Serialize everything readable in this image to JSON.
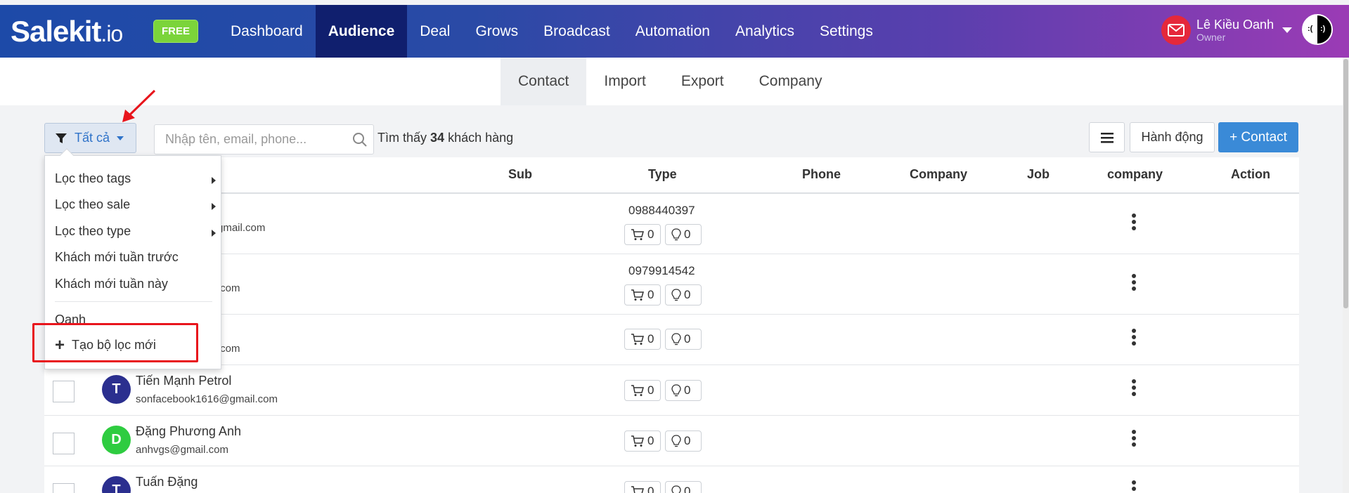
{
  "brand": {
    "name": "Salekit",
    "tld": ".io",
    "badge": "FREE"
  },
  "nav": {
    "items": [
      {
        "label": "Dashboard",
        "active": false
      },
      {
        "label": "Audience",
        "active": true
      },
      {
        "label": "Deal",
        "active": false
      },
      {
        "label": "Grows",
        "active": false
      },
      {
        "label": "Broadcast",
        "active": false
      },
      {
        "label": "Automation",
        "active": false
      },
      {
        "label": "Analytics",
        "active": false
      },
      {
        "label": "Settings",
        "active": false
      }
    ]
  },
  "user": {
    "name": "Lê Kiều Oanh",
    "role": "Owner",
    "avatar_left": ":(",
    "avatar_right": ":)"
  },
  "subnav": {
    "tabs": [
      {
        "label": "Contact",
        "active": true
      },
      {
        "label": "Import",
        "active": false
      },
      {
        "label": "Export",
        "active": false
      },
      {
        "label": "Company",
        "active": false
      }
    ]
  },
  "toolbar": {
    "filter_label": "Tất cả",
    "search_placeholder": "Nhập tên, email, phone...",
    "found_prefix": "Tìm thấy",
    "found_count": "34",
    "found_suffix": "khách hàng",
    "action_label": "Hành động",
    "add_contact_label": "+ Contact"
  },
  "table": {
    "headers": [
      "Sub",
      "Type",
      "Phone",
      "Company",
      "Job",
      "company",
      "Action"
    ],
    "rows": [
      {
        "avatar": "",
        "name": "",
        "email": "gmail.com",
        "phone": "0988440397",
        "orders": "0",
        "deals": "0"
      },
      {
        "avatar": "",
        "name": "",
        "email": ".com",
        "phone": "0979914542",
        "orders": "0",
        "deals": "0"
      },
      {
        "avatar": "",
        "name": "",
        "email": ".com",
        "phone": "",
        "orders": "0",
        "deals": "0"
      },
      {
        "avatar": "T",
        "name": "Tiến Mạnh Petrol",
        "email": "sonfacebook1616@gmail.com",
        "phone": "",
        "orders": "0",
        "deals": "0"
      },
      {
        "avatar": "D",
        "name": "Đặng Phương Anh",
        "email": "anhvgs@gmail.com",
        "phone": "",
        "orders": "0",
        "deals": "0"
      },
      {
        "avatar": "T",
        "name": "Tuấn Đặng",
        "email": "",
        "phone": "",
        "orders": "0",
        "deals": "0"
      }
    ]
  },
  "dropdown": {
    "items": [
      {
        "label": "Lọc theo tags",
        "submenu": true
      },
      {
        "label": "Lọc theo sale",
        "submenu": true
      },
      {
        "label": "Lọc theo type",
        "submenu": true
      },
      {
        "label": "Khách mới tuần trước",
        "submenu": false
      },
      {
        "label": "Khách mới tuần này",
        "submenu": false
      }
    ],
    "saved_filter": "Oanh",
    "create_label": "Tạo bộ lọc mới"
  },
  "colors": {
    "nav_active": "#101f6e",
    "primary": "#3a8ad7",
    "avatar_blue": "#2b2f8f",
    "avatar_green": "#2ecc40",
    "highlight": "#e8151c"
  }
}
